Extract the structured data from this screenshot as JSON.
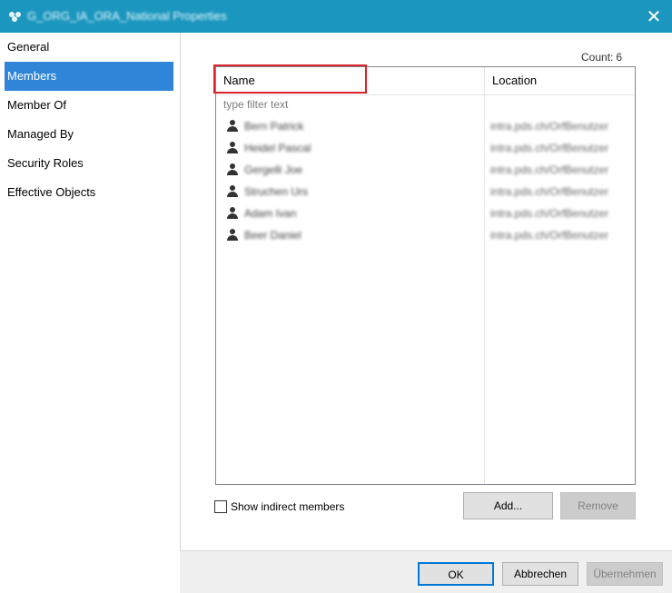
{
  "window": {
    "title": "G_ORG_IA_ORA_National Properties",
    "close_glyph": "✕",
    "accent_color": "#1b97bf"
  },
  "sidebar": {
    "items": [
      {
        "label": "General",
        "active": false
      },
      {
        "label": "Members",
        "active": true
      },
      {
        "label": "Member Of",
        "active": false
      },
      {
        "label": "Managed By",
        "active": false
      },
      {
        "label": "Security Roles",
        "active": false
      },
      {
        "label": "Effective Objects",
        "active": false
      }
    ]
  },
  "members_panel": {
    "count_label": "Count:",
    "count_value": "6",
    "columns": {
      "name": "Name",
      "location": "Location"
    },
    "filter_placeholder": "type filter text",
    "rows": [
      {
        "name": "Bern Patrick",
        "location": "intra.pds.ch/OrfBenutzer"
      },
      {
        "name": "Heidel Pascal",
        "location": "intra.pds.ch/OrfBenutzer"
      },
      {
        "name": "Gergelli Joe",
        "location": "intra.pds.ch/OrfBenutzer"
      },
      {
        "name": "Struchen Urs",
        "location": "intra.pds.ch/OrfBenutzer"
      },
      {
        "name": "Adam Ivan",
        "location": "intra.pds.ch/OrfBenutzer"
      },
      {
        "name": "Beer Daniel",
        "location": "intra.pds.ch/OrfBenutzer"
      }
    ],
    "show_indirect_label": "Show indirect members",
    "add_button": "Add...",
    "remove_button": "Remove"
  },
  "footer": {
    "ok_button": "OK",
    "cancel_button": "Abbrechen",
    "apply_button": "Übernehmen"
  }
}
